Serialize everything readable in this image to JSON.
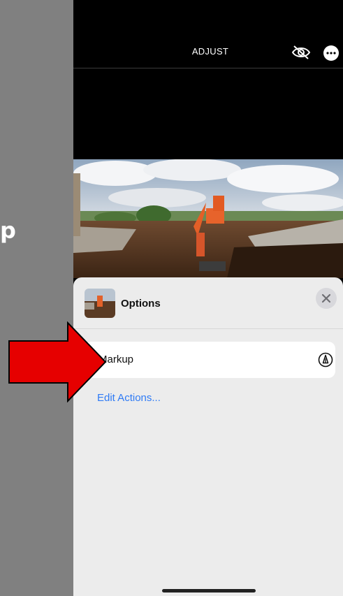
{
  "left_caption": "p",
  "editor": {
    "title": "ADJUST",
    "icons": {
      "visibility": "eye-slash-icon",
      "more": "ellipsis-circle-icon"
    }
  },
  "options_sheet": {
    "title": "Options",
    "close_icon": "close-icon",
    "items": [
      {
        "label": "Markup",
        "icon": "markup-pen-icon"
      }
    ],
    "edit_actions_label": "Edit Actions..."
  },
  "colors": {
    "annotation_arrow": "#e60000",
    "link": "#2f7bf5",
    "sheet_background": "#ececec"
  }
}
